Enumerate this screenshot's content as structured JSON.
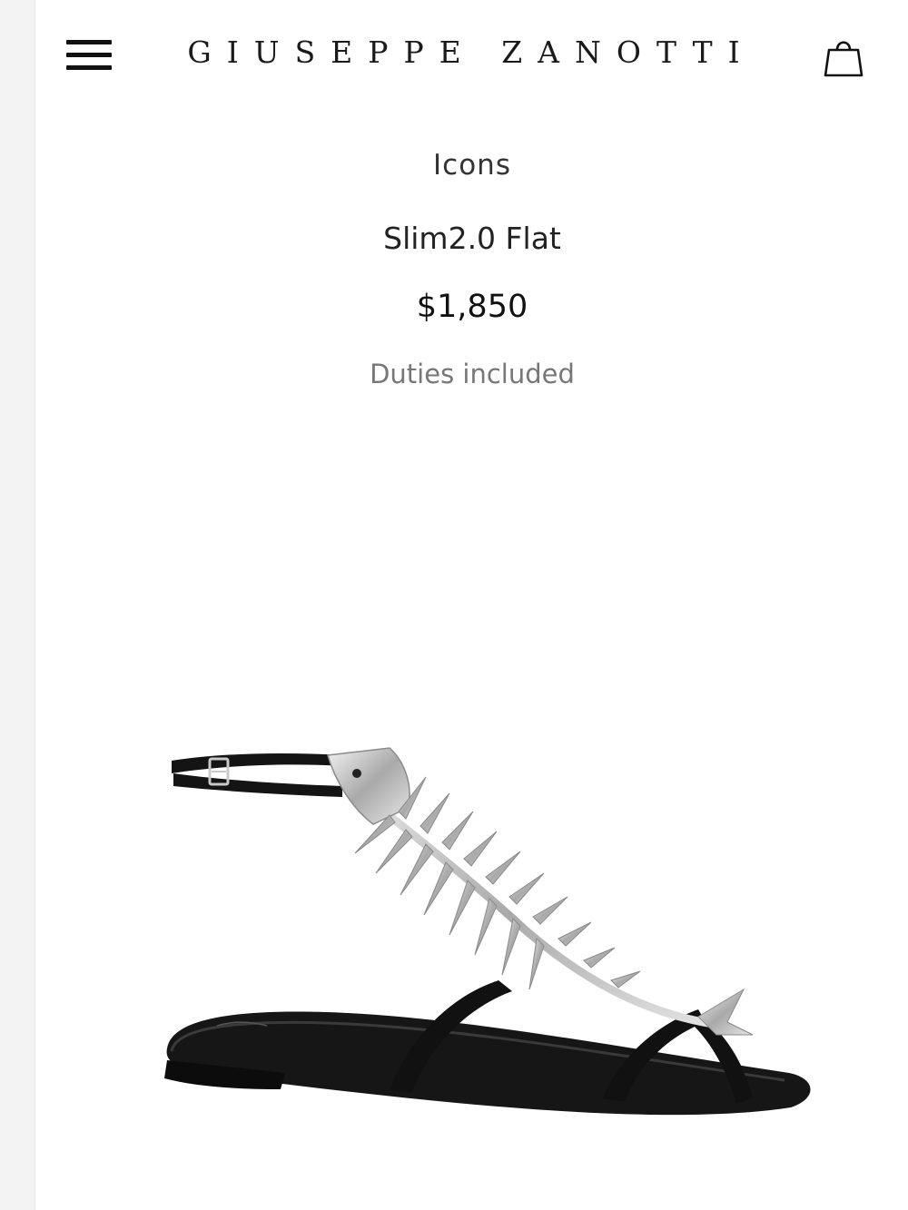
{
  "header": {
    "brand": "GIUSEPPE ZANOTTI",
    "menu_icon": "hamburger-menu-icon",
    "bag_icon": "shopping-bag-icon"
  },
  "product": {
    "collection": "Icons",
    "name": "Slim2.0 Flat",
    "price": "$1,850",
    "duties_note": "Duties included"
  },
  "colors": {
    "text_primary": "#111111",
    "text_secondary": "#777777",
    "background": "#ffffff"
  }
}
